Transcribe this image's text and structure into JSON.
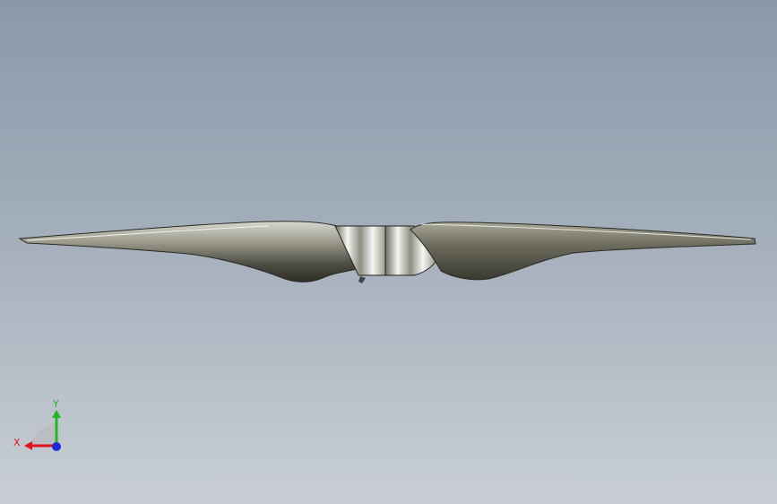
{
  "viewport": {
    "background_top": "#8b98aa",
    "background_bottom": "#c9ced4"
  },
  "model": {
    "object": "propeller",
    "blade_color": "#6e6d5f",
    "hub_color": "#d9d9d4"
  },
  "triad": {
    "x_label": "X",
    "y_label": "Y",
    "x_color": "#e0141e",
    "y_color": "#1fb81f",
    "z_color": "#1a2ad8"
  }
}
